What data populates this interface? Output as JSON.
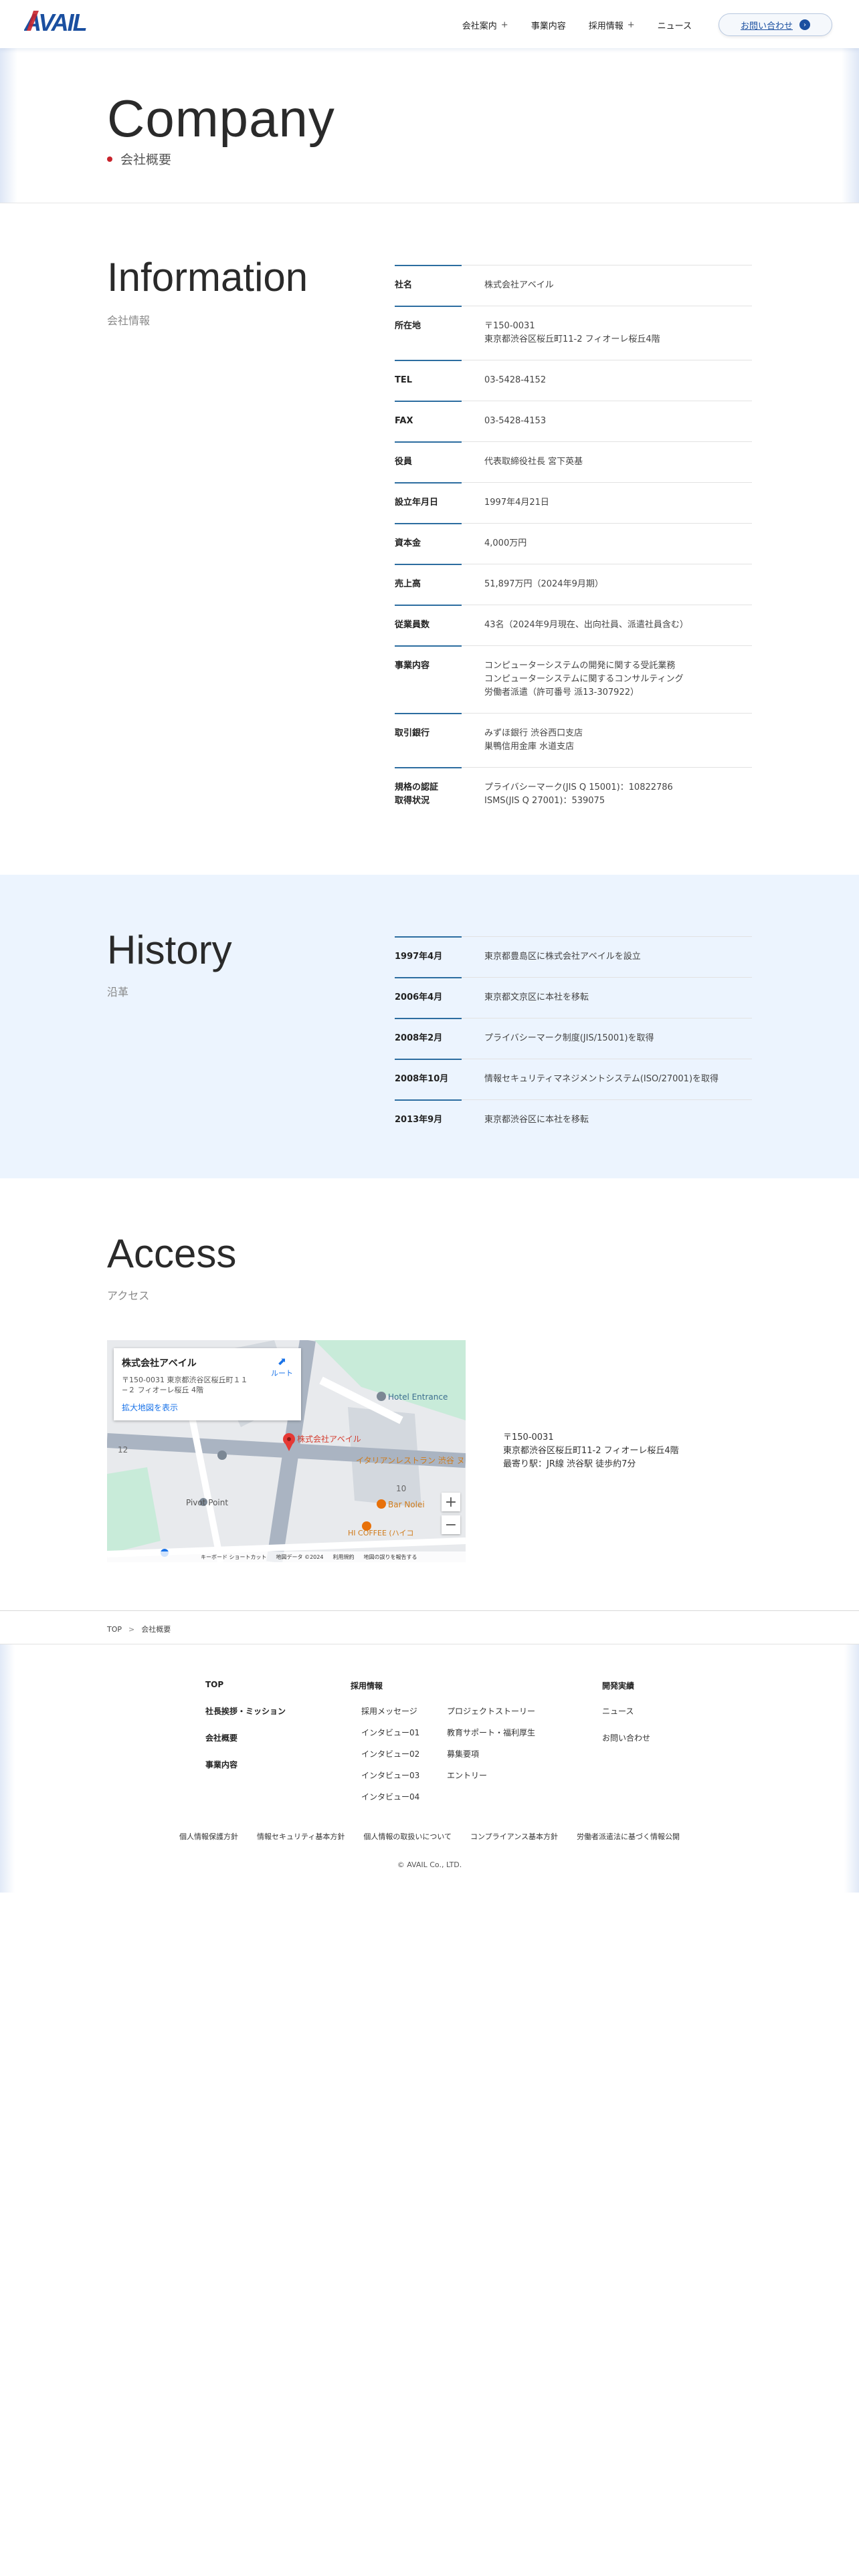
{
  "header": {
    "logo_text": "AVAIL",
    "nav": [
      {
        "label": "会社案内",
        "plus": "+"
      },
      {
        "label": "事業内容",
        "plus": ""
      },
      {
        "label": "採用情報",
        "plus": "+"
      },
      {
        "label": "ニュース",
        "plus": ""
      }
    ],
    "contact_label": "お問い合わせ"
  },
  "hero": {
    "title": "Company",
    "subtitle": "会社概要"
  },
  "info": {
    "title": "Information",
    "subtitle": "会社情報",
    "rows": [
      {
        "k": "社名",
        "v": [
          "株式会社アベイル"
        ]
      },
      {
        "k": "所在地",
        "v": [
          "〒150-0031",
          "東京都渋谷区桜丘町11-2 フィオーレ桜丘4階"
        ]
      },
      {
        "k": "TEL",
        "v": [
          "03-5428-4152"
        ]
      },
      {
        "k": "FAX",
        "v": [
          "03-5428-4153"
        ]
      },
      {
        "k": "役員",
        "v": [
          "代表取締役社長 宮下英基"
        ]
      },
      {
        "k": "設立年月日",
        "v": [
          "1997年4月21日"
        ]
      },
      {
        "k": "資本金",
        "v": [
          "4,000万円"
        ]
      },
      {
        "k": "売上高",
        "v": [
          "51,897万円（2024年9月期）"
        ]
      },
      {
        "k": "従業員数",
        "v": [
          "43名（2024年9月現在、出向社員、派遣社員含む）"
        ]
      },
      {
        "k": "事業内容",
        "v": [
          "コンピューターシステムの開発に関する受託業務",
          "コンピューターシステムに関するコンサルティング",
          "労働者派遣（許可番号 派13-307922）"
        ]
      },
      {
        "k": "取引銀行",
        "v": [
          "みずほ銀行 渋谷西口支店",
          "巣鴨信用金庫 水道支店"
        ]
      },
      {
        "k": "規格の認証\n取得状況",
        "v": [
          "プライバシーマーク(JIS Q 15001)：10822786",
          "ISMS(JIS Q 27001)：539075"
        ]
      }
    ]
  },
  "history": {
    "title": "History",
    "subtitle": "沿革",
    "rows": [
      {
        "k": "1997年4月",
        "v": [
          "東京都豊島区に株式会社アベイルを設立"
        ]
      },
      {
        "k": "2006年4月",
        "v": [
          "東京都文京区に本社を移転"
        ]
      },
      {
        "k": "2008年2月",
        "v": [
          "プライバシーマーク制度(JIS/15001)を取得"
        ]
      },
      {
        "k": "2008年10月",
        "v": [
          "情報セキュリティマネジメントシステム(ISO/27001)を取得"
        ]
      },
      {
        "k": "2013年9月",
        "v": [
          "東京都渋谷区に本社を移転"
        ]
      }
    ]
  },
  "access": {
    "title": "Access",
    "subtitle": "アクセス",
    "map": {
      "card_title": "株式会社アベイル",
      "card_address": "〒150-0031 東京都渋谷区桜丘町１１−２ フィオーレ桜丘 4階",
      "card_link": "拡大地図を表示",
      "route_label": "ルート",
      "pin_label": "株式会社アベイル",
      "labels": [
        "Hotel Entrance",
        "イタリアンレストラン 渋谷 ヌッカ",
        "Bar Nolei",
        "HI COFFEE (ハイコ",
        "Pivot Point",
        "12",
        "10"
      ],
      "footer": [
        "キーボード ショートカット",
        "地図データ ©2024",
        "利用規約",
        "地図の誤りを報告する"
      ]
    },
    "address_lines": [
      "〒150-0031",
      "東京都渋谷区桜丘町11-2 フィオーレ桜丘4階",
      "最寄り駅：JR線 渋谷駅 徒歩約7分"
    ]
  },
  "breadcrumb": {
    "home": "TOP",
    "sep": ">",
    "current": "会社概要"
  },
  "footer": {
    "col1": [
      "TOP",
      "社長挨拶・ミッション",
      "会社概要",
      "事業内容"
    ],
    "col2_head": "採用情報",
    "col2": [
      "採用メッセージ",
      "インタビュー01",
      "インタビュー02",
      "インタビュー03",
      "インタビュー04"
    ],
    "col3": [
      "プロジェクトストーリー",
      "教育サポート・福利厚生",
      "募集要項",
      "エントリー"
    ],
    "col4": [
      "開発実績",
      "ニュース",
      "お問い合わせ"
    ],
    "legal": [
      "個人情報保護方針",
      "情報セキュリティ基本方針",
      "個人情報の取扱いについて",
      "コンプライアンス基本方針",
      "労働者派遣法に基づく情報公開"
    ],
    "copyright": "© AVAIL Co., LTD."
  },
  "colors": {
    "brand_blue": "#1a4fa0",
    "accent_red": "#c8232c",
    "history_bg": "#ecf4fe"
  }
}
